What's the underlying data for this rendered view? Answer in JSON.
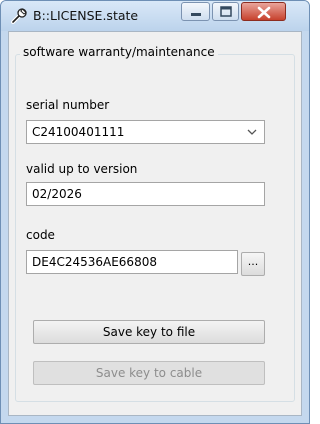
{
  "window": {
    "title": "B::LICENSE.state",
    "icons": {
      "app": "wrench-icon",
      "minimize": "minimize-icon",
      "maximize": "maximize-icon",
      "close": "close-icon"
    }
  },
  "group": {
    "title": "software warranty/maintenance",
    "serial": {
      "label": "serial number",
      "value": "C24100401111"
    },
    "version": {
      "label": "valid up to version",
      "value": "02/2026"
    },
    "code": {
      "label": "code",
      "value": "DE4C24536AE66808",
      "browse_label": "..."
    }
  },
  "buttons": {
    "save_file": "Save key to file",
    "save_cable": "Save key to cable"
  },
  "colors": {
    "close_button": "#c7412d",
    "window_frame": "#c4d8ee",
    "client_bg": "#f0f0f0",
    "disabled_text": "#8d8d8d"
  }
}
